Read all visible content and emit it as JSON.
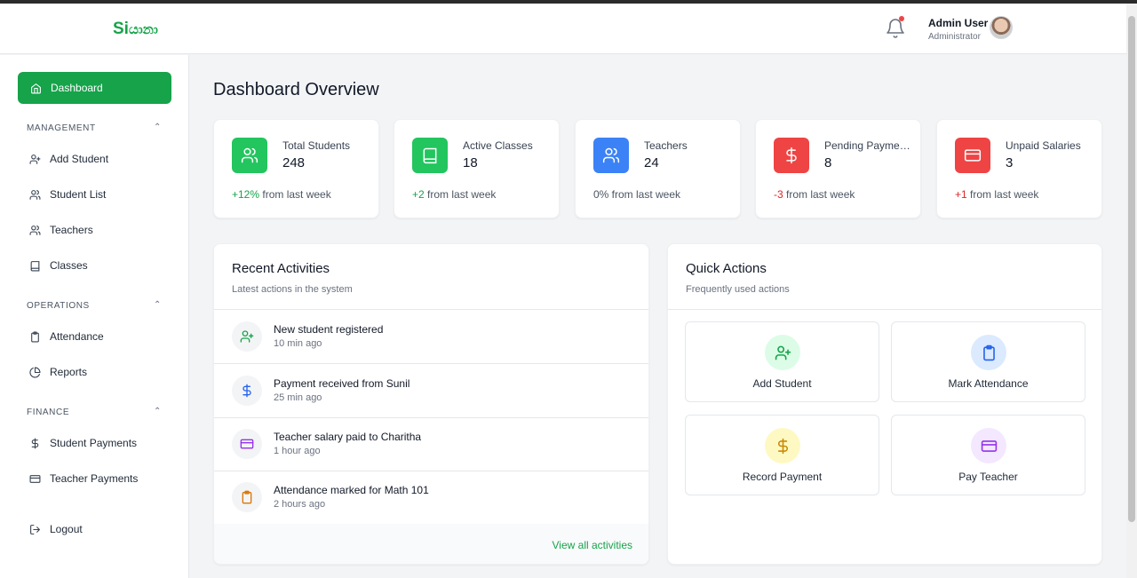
{
  "brand": {
    "logo_prefix": "Si",
    "logo_rest": "යානා"
  },
  "header": {
    "user_name": "Admin User",
    "user_role": "Administrator"
  },
  "sidebar": {
    "active": "Dashboard",
    "sections": [
      {
        "title": "MANAGEMENT",
        "items": [
          "Add Student",
          "Student List",
          "Teachers",
          "Classes"
        ]
      },
      {
        "title": "OPERATIONS",
        "items": [
          "Attendance",
          "Reports"
        ]
      },
      {
        "title": "FINANCE",
        "items": [
          "Student Payments",
          "Teacher Payments"
        ]
      }
    ],
    "logout": "Logout"
  },
  "page": {
    "title": "Dashboard Overview"
  },
  "stats": [
    {
      "label": "Total Students",
      "value": "248",
      "change": "+12%",
      "change_suffix": " from last week",
      "color": "#16a34a",
      "icon": "users-icon"
    },
    {
      "label": "Active Classes",
      "value": "18",
      "change": "+2",
      "change_suffix": " from last week",
      "color": "#16a34a",
      "icon": "book-icon"
    },
    {
      "label": "Teachers",
      "value": "24",
      "change": "0%",
      "change_suffix": " from last week",
      "color": "#3b82f6",
      "icon": "users-icon"
    },
    {
      "label": "Pending Payments",
      "value": "8",
      "change": "-3",
      "change_suffix": " from last week",
      "color": "#ef4444",
      "icon": "dollar-icon"
    },
    {
      "label": "Unpaid Salaries",
      "value": "3",
      "change": "+1",
      "change_suffix": " from last week",
      "color": "#ef4444",
      "icon": "credit-card-icon"
    }
  ],
  "recent": {
    "title": "Recent Activities",
    "subtitle": "Latest actions in the system",
    "items": [
      {
        "text": "New student registered",
        "time": "10 min ago",
        "icon": "user-plus-icon"
      },
      {
        "text": "Payment received from Sunil",
        "time": "25 min ago",
        "icon": "dollar-icon"
      },
      {
        "text": "Teacher salary paid to Charitha",
        "time": "1 hour ago",
        "icon": "credit-card-icon"
      },
      {
        "text": "Attendance marked for Math 101",
        "time": "2 hours ago",
        "icon": "clipboard-icon"
      }
    ],
    "view_all": "View all activities"
  },
  "quick": {
    "title": "Quick Actions",
    "subtitle": "Frequently used actions",
    "actions": [
      {
        "label": "Add Student",
        "icon": "user-plus-icon"
      },
      {
        "label": "Mark Attendance",
        "icon": "clipboard-icon"
      },
      {
        "label": "Record Payment",
        "icon": "dollar-icon"
      },
      {
        "label": "Pay Teacher",
        "icon": "credit-card-icon"
      }
    ]
  }
}
